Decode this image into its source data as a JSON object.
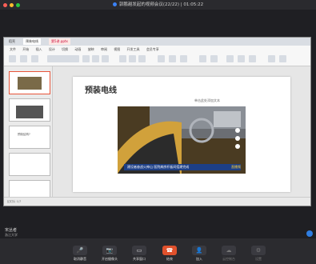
{
  "window": {
    "title": "郭鹏越发起的视频会议(22/22) | 01:05:22"
  },
  "ppt": {
    "tabs": [
      "稻壳",
      "预装电线",
      "第5讲.pptx"
    ],
    "menu": [
      "文件",
      "开始",
      "插入",
      "设计",
      "切换",
      "动画",
      "放映",
      "审阅",
      "视图",
      "开发工具",
      "会员专享"
    ],
    "slide": {
      "title": "预装电线",
      "bullet": "单击此处添加文本",
      "video_caption": "建设者奋战火神山 医院病房杆板间搭建完成",
      "video_tag": "直播频"
    },
    "thumbs": [
      {
        "num": "1"
      },
      {
        "num": "2"
      },
      {
        "num": "3",
        "text": "预制结构?"
      },
      {
        "num": "4"
      },
      {
        "num": "5"
      }
    ],
    "status": "幻灯片 1/7"
  },
  "presenter": {
    "name": "宋丛者",
    "org": "浙江大学"
  },
  "controls": [
    "取消静音",
    "开启摄像头",
    "共享窗口",
    "结束",
    "加入",
    "云控制台",
    "设置"
  ]
}
